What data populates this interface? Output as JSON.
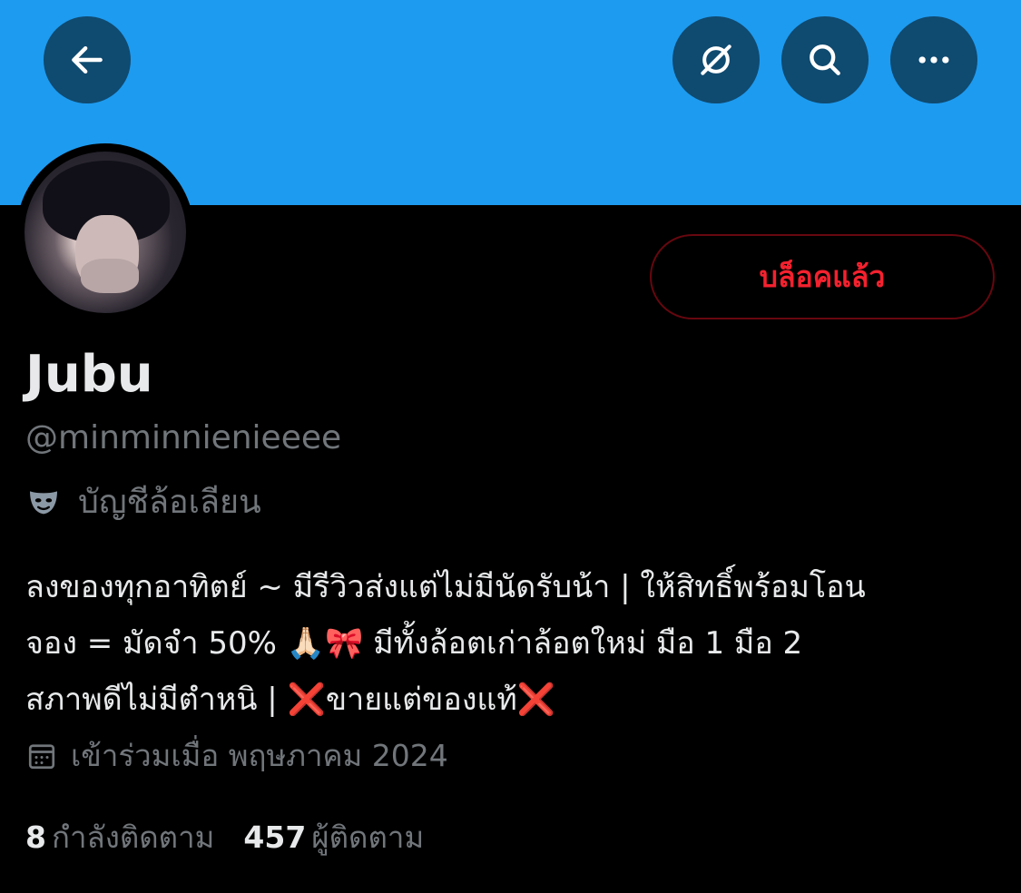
{
  "header": {
    "back_icon": "arrow-left-icon",
    "grok_icon": "grok-icon",
    "search_icon": "search-icon",
    "more_icon": "more-horizontal-icon"
  },
  "profile": {
    "name": "Jubu",
    "handle": "@minminnienieeee",
    "parody_label": "บัญชีล้อเลียน",
    "blocked_label": "บล็อคแล้ว",
    "bio": "ลงของทุกอาทิตย์ ~ มีรีวิวส่งแต่ไม่มีนัดรับน้า | ให้สิทธิ์พร้อมโอน\nจอง = มัดจำ 50% 🙏🏻🎀 มีทั้งล้อตเก่าล้อตใหม่ มือ 1 มือ 2\nสภาพดีไม่มีตำหนิ | ❌ขายแต่ของแท้❌",
    "joined": "เข้าร่วมเมื่อ พฤษภาคม 2024",
    "following_count": "8",
    "following_label": "กำลังติดตาม",
    "followers_count": "457",
    "followers_label": "ผู้ติดตาม"
  },
  "colors": {
    "banner": "#1d9bf0",
    "blocked_text": "#f4212e",
    "blocked_border": "#67070f",
    "muted": "#71767b"
  }
}
